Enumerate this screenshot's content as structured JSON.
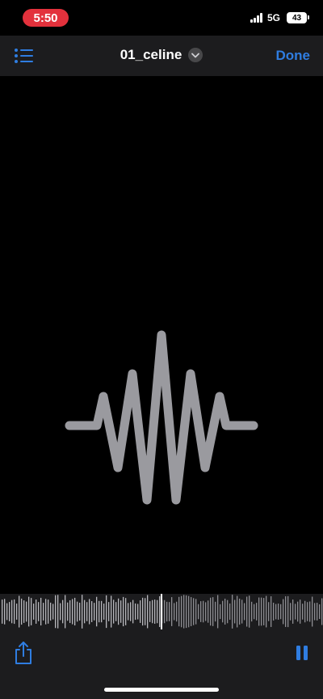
{
  "status_bar": {
    "time": "5:50",
    "network": "5G",
    "battery": "43"
  },
  "nav": {
    "title": "01_celine",
    "done_label": "Done",
    "list_icon": "list-icon",
    "chevron_icon": "chevron-down-icon"
  },
  "player": {
    "state": "playing",
    "waveform_icon": "waveform-icon",
    "share_icon": "share-icon",
    "pause_icon": "pause-icon"
  },
  "colors": {
    "accent": "#2f7de1",
    "recording_pill": "#e3313c",
    "waveform": "#9a9a9f",
    "bar_background": "#1c1c1e"
  }
}
